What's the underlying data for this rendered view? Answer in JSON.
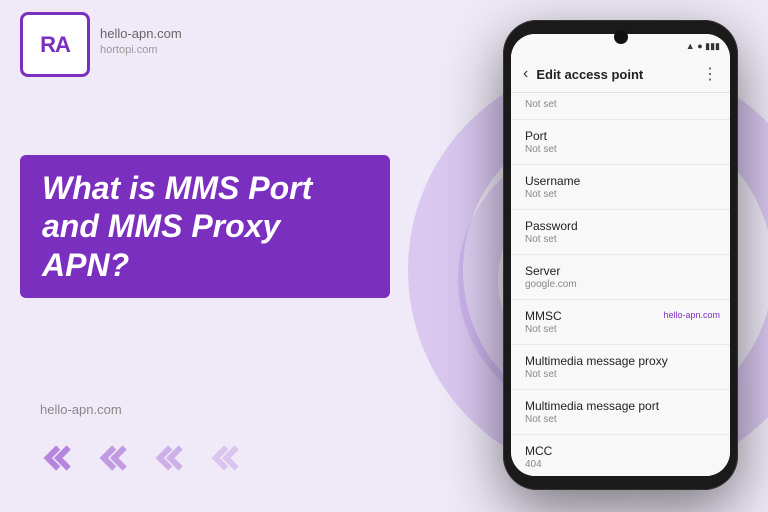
{
  "site": {
    "url": "hello-apn.com",
    "url2": "hortopi.com"
  },
  "logo": {
    "text": "RA"
  },
  "heading": {
    "line1": "What is MMS Port",
    "line2": "and MMS Proxy APN?"
  },
  "footer": {
    "url_left": "hello-apn.com",
    "url_right": "hello-apn.com"
  },
  "phone": {
    "title": "Edit access point",
    "settings": [
      {
        "label": "Port",
        "value": "Not set"
      },
      {
        "label": "Username",
        "value": "Not set"
      },
      {
        "label": "Password",
        "value": "Not set"
      },
      {
        "label": "Server",
        "value": "google.com"
      },
      {
        "label": "MMSC",
        "value": "Not set",
        "value_accent": "hello-apn.com"
      },
      {
        "label": "Multimedia message proxy",
        "value": "Not set"
      },
      {
        "label": "Multimedia message port",
        "value": "Not set"
      },
      {
        "label": "MCC",
        "value": "404"
      }
    ]
  },
  "chevrons": [
    "❮❮",
    "❮❮",
    "❮❮",
    "❮❮"
  ]
}
